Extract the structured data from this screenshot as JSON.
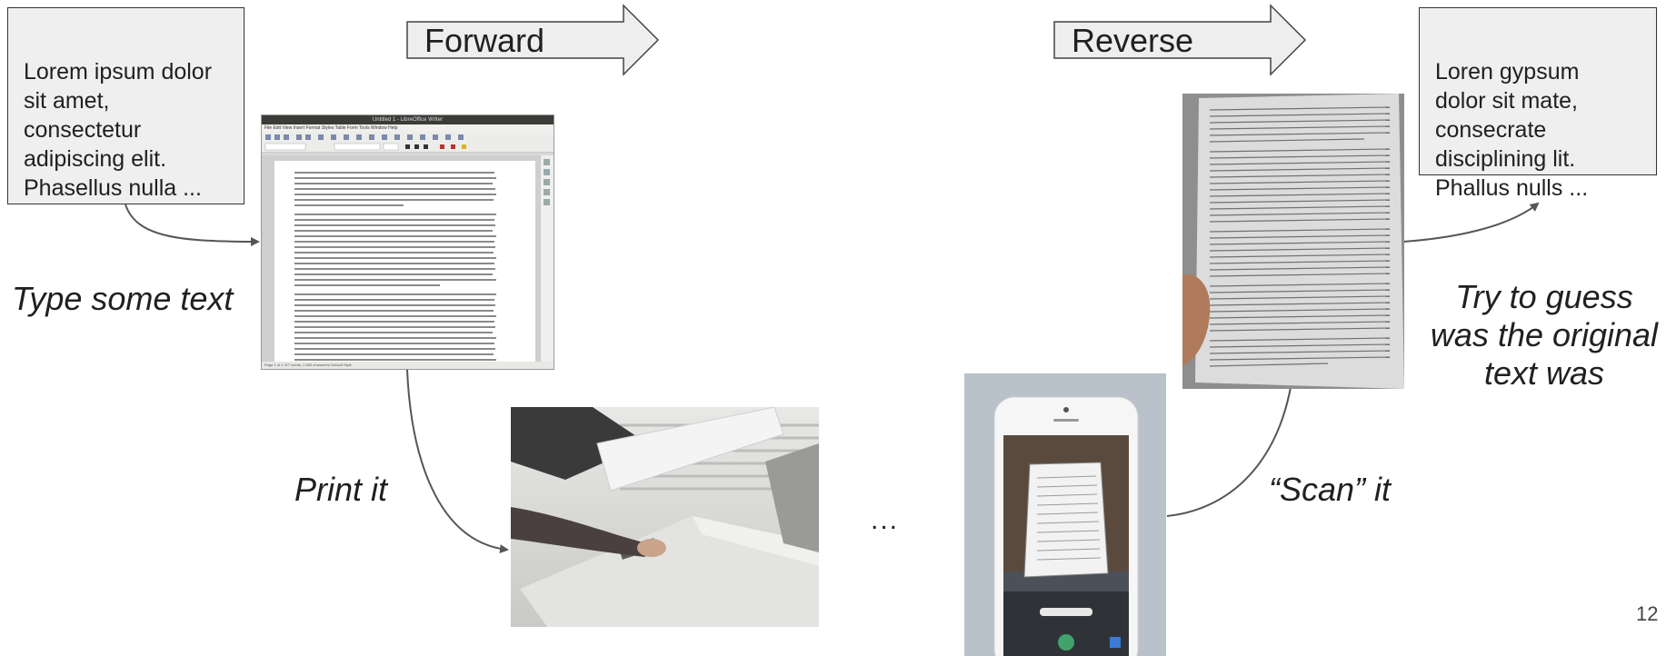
{
  "left_box": {
    "text": "Lorem ipsum dolor\nsit amet,\nconsectetur\nadipiscing elit.\nPhasellus nulla ..."
  },
  "right_box": {
    "text": "Loren gypsum\ndolor sit mate,\nconsecrate\ndisciplining lit.\nPhallus nulls ..."
  },
  "arrows": {
    "forward": "Forward",
    "reverse": "Reverse"
  },
  "captions": {
    "type_text": "Type some text",
    "print_it": "Print it",
    "scan_it": "“Scan” it",
    "guess": "Try to guess\nwas the original\ntext was",
    "ellipsis": "..."
  },
  "writer": {
    "title": "Untitled 1 - LibreOffice Writer",
    "menu": "File  Edit  View  Insert  Format  Styles  Table  Form  Tools  Window  Help",
    "status": "Page 1 of 1     377 words, 2,650 characters          Default Style"
  },
  "page_number": "12",
  "colors": {
    "box_fill": "#efefef",
    "arrow_fill": "#eeeeee",
    "connector": "#555555"
  }
}
